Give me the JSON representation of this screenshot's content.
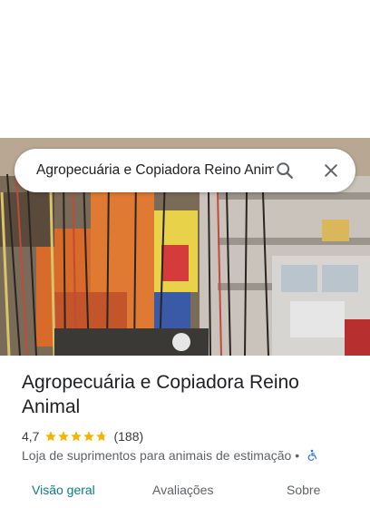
{
  "search": {
    "query": "Agropecuária e Copiadora Reino Animal"
  },
  "place": {
    "name": "Agropecuária e Copiadora Reino Animal",
    "rating": "4,7",
    "stars": 4.7,
    "reviews": "(188)",
    "category": "Loja de suprimentos para animais de estimação",
    "separator": "•"
  },
  "icons": {
    "search": "search-icon",
    "close": "close-icon",
    "star": "star-icon",
    "accessibility": "wheelchair-icon"
  },
  "tabs": [
    {
      "label": "Visão geral",
      "active": true
    },
    {
      "label": "Avaliações",
      "active": false
    },
    {
      "label": "Sobre",
      "active": false
    }
  ],
  "colors": {
    "star": "#f4b400",
    "active_tab": "#0b7a8c",
    "accessibility": "#1a73e8"
  }
}
